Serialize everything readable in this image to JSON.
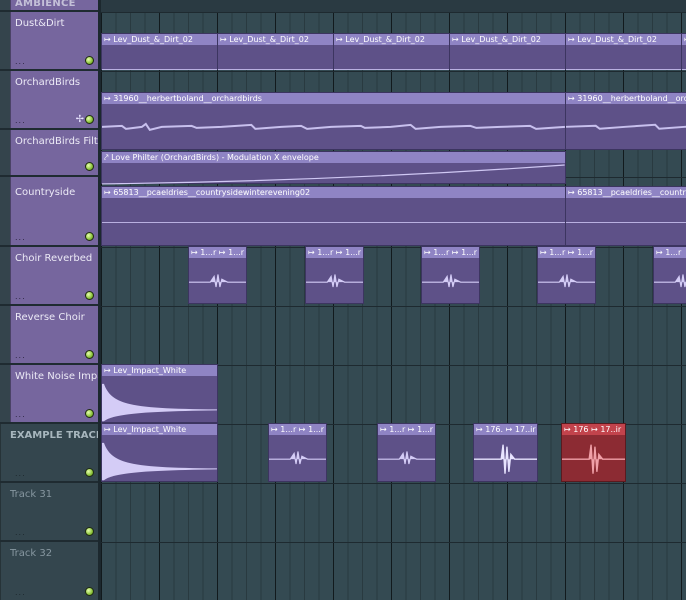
{
  "tracks": [
    {
      "name": "AMBIENCE"
    },
    {
      "name": "Dust&Dirt"
    },
    {
      "name": "OrchardBirds"
    },
    {
      "name": "OrchardBirds Filter"
    },
    {
      "name": "Countryside"
    },
    {
      "name": "Choir Reverbed"
    },
    {
      "name": "Reverse Choir"
    },
    {
      "name": "White Noise Impact"
    },
    {
      "name": "EXAMPLE TRACK"
    },
    {
      "name": "Track 31"
    },
    {
      "name": "Track 32"
    }
  ],
  "track_dots": "...",
  "clips": {
    "dust": "Lev_Dust_&_Dirt_02",
    "birds": "31960__herbertboland__orchardbirds",
    "filter": "Love Philter (OrchardBirds) - Modulation X envelope",
    "countryside": "65813__pcaeldries__countrysidewinterevening02",
    "choir_short": "1...r",
    "impact": "Lev_Impact_White",
    "example_a": "176.",
    "example_b": "17..ir",
    "example_red_a": "176",
    "example_red_b": "17..ir"
  },
  "colors": {
    "accent": "#76669e",
    "clip_header": "#8f84c4",
    "selected_clip": "#c2434c",
    "led": "#8bc33a"
  }
}
